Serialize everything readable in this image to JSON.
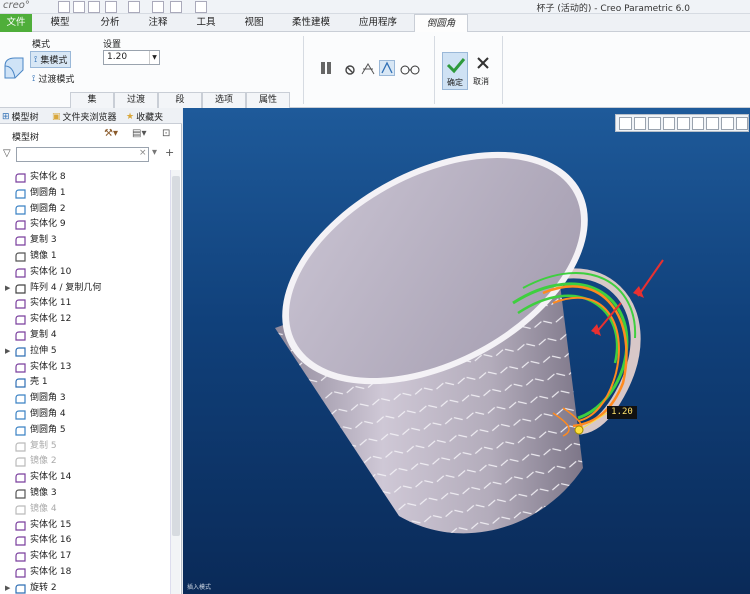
{
  "app": {
    "logo": "creo°",
    "window_title": "杯子 (活动的) - Creo Parametric 6.0"
  },
  "tabs": [
    {
      "label": "文件",
      "name": "tab-file"
    },
    {
      "label": "模型",
      "name": "tab-model"
    },
    {
      "label": "分析",
      "name": "tab-analysis"
    },
    {
      "label": "注释",
      "name": "tab-annotate"
    },
    {
      "label": "工具",
      "name": "tab-tools"
    },
    {
      "label": "视图",
      "name": "tab-view"
    },
    {
      "label": "柔性建模",
      "name": "tab-flexible-modeling"
    },
    {
      "label": "应用程序",
      "name": "tab-applications"
    },
    {
      "label": "倒圆角",
      "name": "tab-round"
    }
  ],
  "ribbon": {
    "mode_label": "模式",
    "settings_label": "设置",
    "set_mode": "集模式",
    "transition_mode": "过渡模式",
    "radius_value": "1.20",
    "ok_label": "确定",
    "cancel_label": "取消",
    "subtabs": [
      "集",
      "过渡",
      "段",
      "选项",
      "属性"
    ]
  },
  "panel": {
    "tabs": [
      "模型树",
      "文件夹浏览器",
      "收藏夹"
    ],
    "tree_title": "模型树",
    "search_placeholder": ""
  },
  "tree": [
    {
      "label": "实体化 8",
      "icon": "solidify-icon",
      "dim": false,
      "expandable": false
    },
    {
      "label": "倒圆角 1",
      "icon": "round-icon",
      "dim": false,
      "expandable": false
    },
    {
      "label": "倒圆角 2",
      "icon": "round-icon",
      "dim": false,
      "expandable": false
    },
    {
      "label": "实体化 9",
      "icon": "solidify-icon",
      "dim": false,
      "expandable": false
    },
    {
      "label": "复制 3",
      "icon": "copy-icon",
      "dim": false,
      "expandable": false
    },
    {
      "label": "镜像 1",
      "icon": "mirror-icon",
      "dim": false,
      "expandable": false
    },
    {
      "label": "实体化 10",
      "icon": "solidify-icon",
      "dim": false,
      "expandable": false
    },
    {
      "label": "阵列 4 / 复制几何",
      "icon": "pattern-icon",
      "dim": false,
      "expandable": true
    },
    {
      "label": "实体化 11",
      "icon": "solidify-icon",
      "dim": false,
      "expandable": false
    },
    {
      "label": "实体化 12",
      "icon": "solidify-icon",
      "dim": false,
      "expandable": false
    },
    {
      "label": "复制 4",
      "icon": "copy-icon",
      "dim": false,
      "expandable": false
    },
    {
      "label": "拉伸 5",
      "icon": "extrude-icon",
      "dim": false,
      "expandable": true
    },
    {
      "label": "实体化 13",
      "icon": "solidify-icon",
      "dim": false,
      "expandable": false
    },
    {
      "label": "壳 1",
      "icon": "shell-icon",
      "dim": false,
      "expandable": false
    },
    {
      "label": "倒圆角 3",
      "icon": "round-icon",
      "dim": false,
      "expandable": false
    },
    {
      "label": "倒圆角 4",
      "icon": "round-icon",
      "dim": false,
      "expandable": false
    },
    {
      "label": "倒圆角 5",
      "icon": "round-icon",
      "dim": false,
      "expandable": false
    },
    {
      "label": "复制 5",
      "icon": "copy-icon",
      "dim": true,
      "expandable": false
    },
    {
      "label": "镜像 2",
      "icon": "mirror-icon",
      "dim": true,
      "expandable": false
    },
    {
      "label": "实体化 14",
      "icon": "solidify-icon",
      "dim": false,
      "expandable": false
    },
    {
      "label": "镜像 3",
      "icon": "mirror-icon",
      "dim": false,
      "expandable": false
    },
    {
      "label": "镜像 4",
      "icon": "mirror-icon",
      "dim": true,
      "expandable": false
    },
    {
      "label": "实体化 15",
      "icon": "solidify-icon",
      "dim": false,
      "expandable": false
    },
    {
      "label": "实体化 16",
      "icon": "solidify-icon",
      "dim": false,
      "expandable": false
    },
    {
      "label": "实体化 17",
      "icon": "solidify-icon",
      "dim": false,
      "expandable": false
    },
    {
      "label": "实体化 18",
      "icon": "solidify-icon",
      "dim": false,
      "expandable": false
    },
    {
      "label": "旋转 2",
      "icon": "revolve-icon",
      "dim": false,
      "expandable": true
    }
  ],
  "viewport": {
    "dimension_value": "1.20",
    "status_text": "插入模式"
  },
  "colors": {
    "file_tab": "#4fae3a",
    "viewport_top": "#1e5a9a",
    "viewport_bottom": "#0a2a58",
    "mug_body": "#b8b0bf",
    "edge_green": "#3fcf3f",
    "edge_orange": "#ff8a1e",
    "arrow_red": "#e83030"
  }
}
